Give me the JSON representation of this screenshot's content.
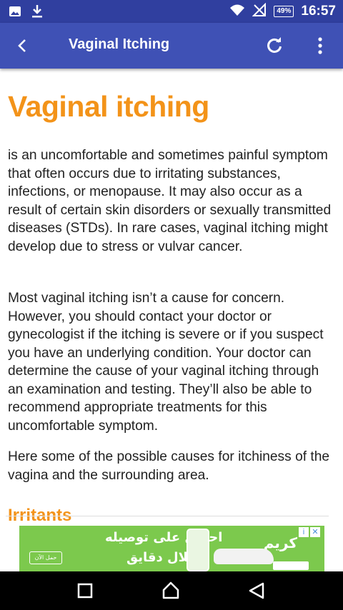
{
  "status_bar": {
    "time": "16:57",
    "battery": "49%",
    "icons": [
      "image-icon",
      "download-icon",
      "wifi-icon",
      "signal-icon",
      "battery-icon"
    ]
  },
  "app_bar": {
    "title": "Vaginal Itching",
    "back_icon": "back-arrow-icon",
    "refresh_icon": "refresh-icon",
    "menu_icon": "more-vert-icon"
  },
  "article": {
    "heading": "Vaginal itching",
    "paragraphs": [
      "is an uncomfortable and sometimes painful symptom that often occurs due to irritating substances, infections, or menopause. It may also occur as a result of certain skin disorders or sexually transmitted diseases (STDs). In rare cases, vaginal itching might develop due to stress or vulvar cancer.",
      "Most vaginal itching isn’t a cause for concern. However, you should contact your doctor or gynecologist if the itching is severe or if you suspect you have an underlying condition. Your doctor can determine the cause of your vaginal itching through an examination and testing. They’ll also be able to recommend appropriate treatments for this uncomfortable symptom.",
      "Here some of the possible causes for itchiness of the vagina and the surrounding area."
    ],
    "subheading": "Irritants"
  },
  "ad": {
    "brand": "كريم",
    "line1": "احصل على توصيله",
    "line2": "خلال دقايق",
    "button": "حمل الآن",
    "info_icon": "adchoices-icon",
    "close_icon": "close-icon"
  },
  "nav_bar": {
    "recent_icon": "recent-apps-icon",
    "home_icon": "home-icon",
    "back_icon": "nav-back-icon"
  },
  "colors": {
    "status_bar": "#303f9f",
    "app_bar": "#3f51b5",
    "heading": "#f39319",
    "ad_background": "#7cc94d"
  }
}
